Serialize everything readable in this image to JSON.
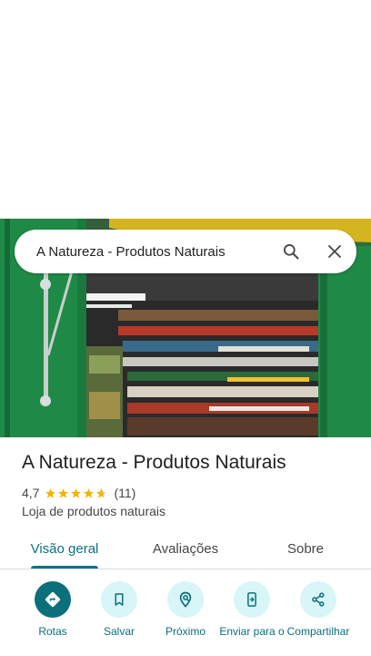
{
  "search": {
    "query": "A Natureza - Produtos Naturais"
  },
  "place": {
    "name": "A Natureza - Produtos Naturais",
    "rating": "4,7",
    "stars": 4.7,
    "review_count": "(11)",
    "category": "Loja de produtos naturais"
  },
  "tabs": [
    {
      "label": "Visão geral",
      "active": true
    },
    {
      "label": "Avaliações",
      "active": false
    },
    {
      "label": "Sobre",
      "active": false
    }
  ],
  "actions": [
    {
      "label": "Rotas",
      "icon": "directions-icon"
    },
    {
      "label": "Salvar",
      "icon": "bookmark-icon"
    },
    {
      "label": "Próximo",
      "icon": "nearby-icon"
    },
    {
      "label": "Enviar para o",
      "icon": "send-to-phone-icon"
    },
    {
      "label": "Compartilhar",
      "icon": "share-icon"
    }
  ],
  "colors": {
    "accent": "#0b6f7c",
    "action_bg": "#d8f5f8",
    "star": "#f4b400"
  }
}
